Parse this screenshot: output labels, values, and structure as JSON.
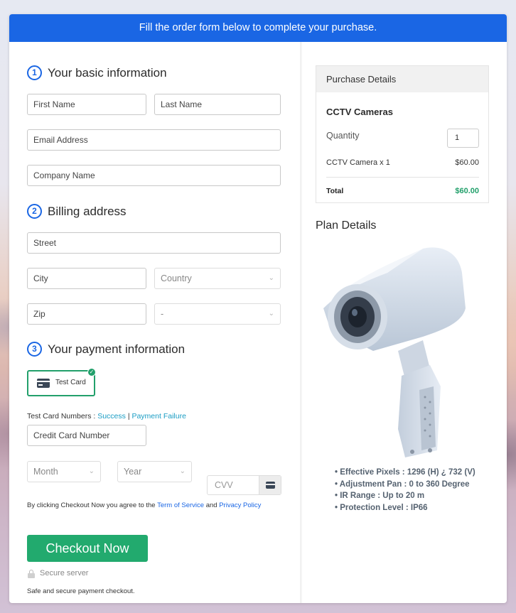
{
  "banner": {
    "text": "Fill the order form below to complete your purchase."
  },
  "sections": {
    "basic": {
      "number": "1",
      "title": "Your basic information"
    },
    "billing": {
      "number": "2",
      "title": "Billing address"
    },
    "payment": {
      "number": "3",
      "title": "Your payment information"
    }
  },
  "fields": {
    "first_name": {
      "placeholder": "First Name"
    },
    "last_name": {
      "placeholder": "Last Name"
    },
    "email": {
      "placeholder": "Email Address"
    },
    "company": {
      "placeholder": "Company Name"
    },
    "street": {
      "placeholder": "Street"
    },
    "city": {
      "placeholder": "City"
    },
    "country": {
      "selected": "Country"
    },
    "zip": {
      "placeholder": "Zip"
    },
    "state": {
      "selected": "-"
    },
    "card_number": {
      "placeholder": "Credit Card Number"
    },
    "month": {
      "selected": "Month"
    },
    "year": {
      "selected": "Year"
    },
    "cvv": {
      "placeholder": "CVV"
    }
  },
  "payment": {
    "method_label": "Test Card",
    "test_numbers_label": "Test Card Numbers :",
    "success_link": "Success",
    "separator": "|",
    "failure_link": "Payment Failure"
  },
  "agreement": {
    "prefix": "By clicking Checkout Now you agree to the",
    "tos_link": "Term of Service",
    "and": "and",
    "privacy_link": "Privacy Policy"
  },
  "checkout_button": "Checkout Now",
  "secure": {
    "label": "Secure server",
    "note": "Safe and secure payment checkout."
  },
  "purchase_details": {
    "title": "Purchase Details",
    "product": "CCTV Cameras",
    "quantity_label": "Quantity",
    "quantity": "1",
    "line_item": "CCTV Camera x 1",
    "line_price": "$60.00",
    "total_label": "Total",
    "total": "$60.00"
  },
  "plan": {
    "title": "Plan Details",
    "image_icon": "cctv-camera-image",
    "features": [
      "Effective Pixels : 1296 (H) ¿ 732 (V)",
      "Adjustment Pan : 0 to 360 Degree",
      "IR Range : Up to 20 m",
      "Protection Level : IP66"
    ]
  },
  "colors": {
    "primary": "#1a66e4",
    "success": "#22aa6e",
    "link": "#1a9dc4",
    "total": "#22a06b"
  }
}
